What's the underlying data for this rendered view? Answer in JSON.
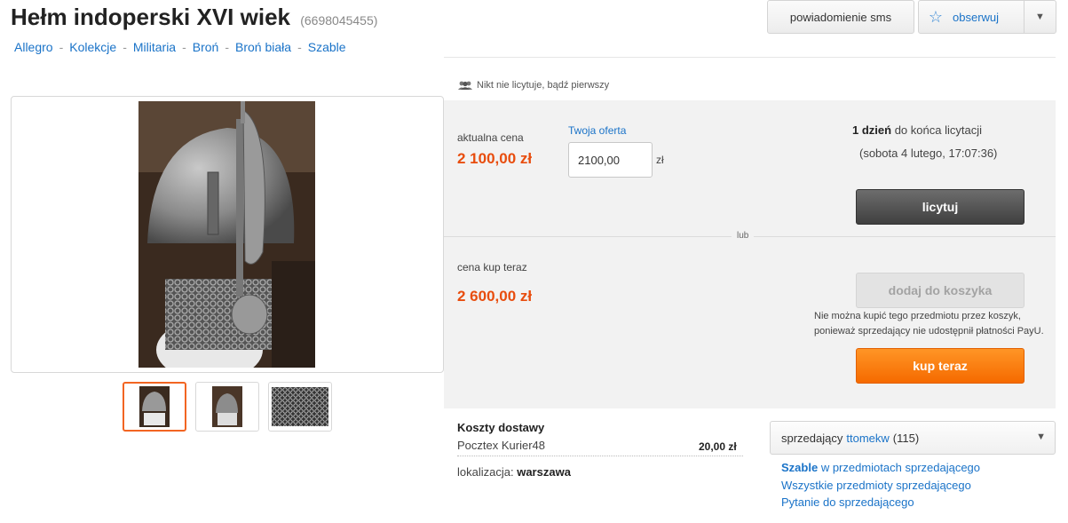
{
  "header": {
    "title": "Hełm indoperski XVI wiek",
    "offer_id": "(6698045455)",
    "sms_button": "powiadomienie sms",
    "watch_button": "obserwuj"
  },
  "breadcrumbs": [
    "Allegro",
    "Kolekcje",
    "Militaria",
    "Broń",
    "Broń biała",
    "Szable"
  ],
  "bidding": {
    "no_bids_text": "Nikt nie licytuje, bądź pierwszy",
    "current_price_label": "aktualna cena",
    "current_price": "2 100,00 zł",
    "your_offer_label": "Twoja oferta",
    "your_offer_value": "2100,00",
    "currency": "zł",
    "time_left_bold": "1 dzień",
    "time_left_rest": "do końca licytacji",
    "end_date": "(sobota 4 lutego, 17:07:36)",
    "bid_button": "licytuj",
    "or_label": "lub"
  },
  "buy_now": {
    "label": "cena kup teraz",
    "price": "2 600,00 zł",
    "cart_button": "dodaj do koszyka",
    "cart_note_line1": "Nie można kupić tego przedmiotu przez koszyk,",
    "cart_note_line2": "ponieważ sprzedający nie udostępnił płatności PayU.",
    "buy_button": "kup teraz"
  },
  "delivery": {
    "title": "Koszty dostawy",
    "method": "Pocztex Kurier48",
    "cost": "20,00 zł",
    "location_label": "lokalizacja:",
    "location_value": "warszawa"
  },
  "seller": {
    "label": "sprzedający",
    "name": "ttomekw",
    "rating": "(115)",
    "link1_bold": "Szable",
    "link1_rest": "w przedmiotach sprzedającego",
    "link2": "Wszystkie przedmioty sprzedającego",
    "link3": "Pytanie do sprzedającego"
  },
  "colors": {
    "accent_orange": "#f56a00",
    "price_red": "#e84d0e",
    "link_blue": "#1a73c8"
  }
}
